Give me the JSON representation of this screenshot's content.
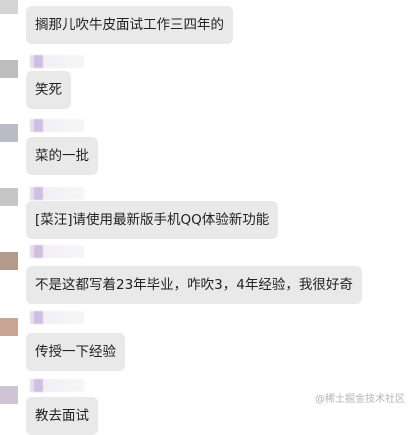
{
  "messages": [
    {
      "text": "搁那儿吹牛皮面试工作三四年的"
    },
    {
      "text": "笑死"
    },
    {
      "text": "菜的一批"
    },
    {
      "text": "[菜汪]请使用最新版手机QQ体验新功能"
    },
    {
      "text": "不是这都写着23年毕业，咋吹3，4年经验，我很好奇"
    },
    {
      "text": "传授一下经验"
    },
    {
      "text": "教去面试"
    }
  ],
  "watermark": {
    "text": "@稀土掘金技术社区"
  }
}
